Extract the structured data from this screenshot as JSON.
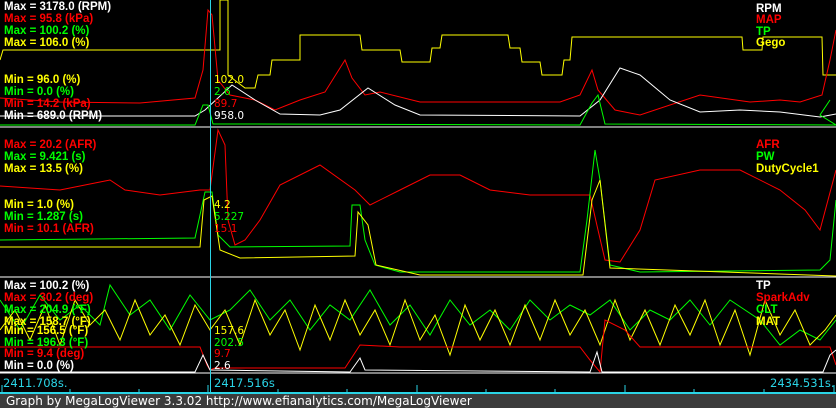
{
  "panels": [
    {
      "max": [
        "Max = 3178.0 (RPM)",
        "Max = 95.8 (kPa)",
        "Max = 100.2 (%)",
        "Max = 106.0 (%)"
      ],
      "min": [
        "Min = 96.0 (%)",
        "Min = 0.0 (%)",
        "Min = 14.2 (kPa)",
        "Min = 689.0 (RPM)"
      ],
      "values": [
        "102.0",
        "2.6",
        "89.7",
        "958.0"
      ],
      "legend": [
        "RPM",
        "MAP",
        "TP",
        "Gego"
      ]
    },
    {
      "max": [
        "Max = 20.2 (AFR)",
        "Max = 9.421 (s)",
        "Max = 13.5 (%)"
      ],
      "min": [
        "Min = 1.0 (%)",
        "Min = 1.287 (s)",
        "Min = 10.1 (AFR)"
      ],
      "values": [
        "4.2",
        "5.227",
        "15.1"
      ],
      "legend": [
        "AFR",
        "PW",
        "DutyCycle1"
      ]
    },
    {
      "max": [
        "Max = 100.2 (%)",
        "Max = 30.2 (deg)",
        "Max = 204.9 (°F)",
        "Max = 158.7 (°F)"
      ],
      "min": [
        "Min = 156.5 (°F)",
        "Min = 196.3 (°F)",
        "Min = 9.4 (deg)",
        "Min = 0.0 (%)"
      ],
      "values": [
        "157.6",
        "202.5",
        "9.7",
        "2.6"
      ],
      "legend": [
        "TP",
        "SparkAdv",
        "CLT",
        "MAT"
      ]
    }
  ],
  "timeline": {
    "start": "2411.708s.",
    "cursor": "2417.516s",
    "end": "2434.531s."
  },
  "footer": "Graph by MegaLogViewer 3.3.02 http://www.efianalytics.com/MegaLogViewer",
  "colors": {
    "cursor": "#2ad4e6",
    "rpm": "#ffffff",
    "map": "#ff0000",
    "tp": "#00ff00",
    "gego": "#ffff00"
  }
}
